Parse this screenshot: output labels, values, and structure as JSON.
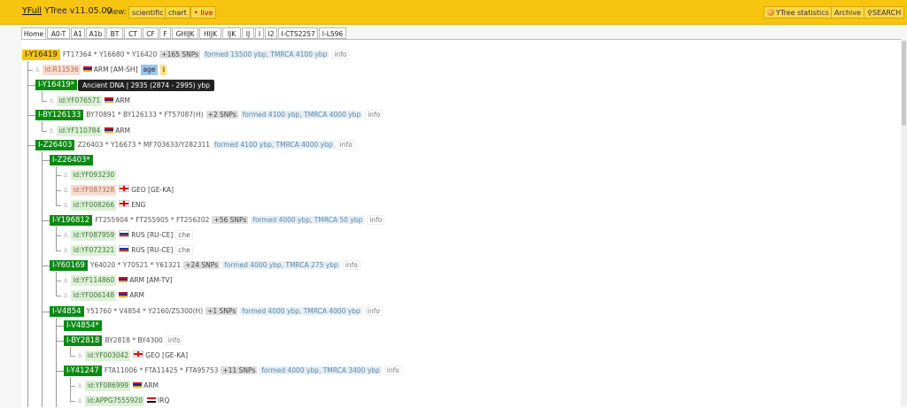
{
  "header": {
    "brand_yfull": "YFull",
    "brand_rest": "YTree v11.05.00",
    "view_label": "View:",
    "view_buttons": [
      "scientific",
      "chart",
      "• live"
    ],
    "stats": "YTree statistics",
    "archive": "Archive",
    "search": "SEARCH"
  },
  "tabs": [
    "Home",
    "A0-T",
    "A1",
    "A1b",
    "BT",
    "CT",
    "CF",
    "F",
    "GHIJK",
    "HIJK",
    "IJK",
    "IJ",
    "I",
    "I2",
    "I-CTS2257",
    "I-L596"
  ],
  "tree": {
    "root": {
      "name": "I-Y16419",
      "snps": "FT17364 * Y16680 * Y16420",
      "count": "+165 SNPs",
      "formed": "formed 15500 ybp, TMRCA 4100 ybp",
      "info": "info"
    },
    "root_sample": {
      "id": "id:R11536",
      "country": "ARM [AM-SH]",
      "age": "age",
      "age_icon": "ℹ"
    },
    "tooltip": "Ancient DNA | 2935 (2874 - 2995) ybp",
    "n_y16419s": {
      "name": "I-Y16419*"
    },
    "s_yf076571": {
      "id": "id:YF076571",
      "country": "ARM"
    },
    "n_by126133": {
      "name": "I-BY126133",
      "snps": "BY70891 * BY126133 * FT57087(H)",
      "count": "+2 SNPs",
      "formed": "formed 4100 ybp, TMRCA 4000 ybp",
      "info": "info"
    },
    "s_yf110784": {
      "id": "id:YF110784",
      "country": "ARM"
    },
    "n_z26403": {
      "name": "I-Z26403",
      "snps": "Z26403 * Y16673 * MF703633/Y282311",
      "formed": "formed 4100 ybp, TMRCA 4000 ybp",
      "info": "info"
    },
    "n_z26403s": {
      "name": "I-Z26403*"
    },
    "s_yf093230": {
      "id": "id:YF093230"
    },
    "s_yf087328": {
      "id": "id:YF087328",
      "country": "GEO [GE-KA]"
    },
    "s_yf008266": {
      "id": "id:YF008266",
      "country": "ENG"
    },
    "n_y196812": {
      "name": "I-Y196812",
      "snps": "FT255904 * FT255905 * FT256202",
      "count": "+56 SNPs",
      "formed": "formed 4000 ybp, TMRCA 50 ybp",
      "info": "info"
    },
    "s_yf087959": {
      "id": "id:YF087959",
      "country": "RUS [RU-CE]",
      "tag": "che"
    },
    "s_yf072321": {
      "id": "id:YF072321",
      "country": "RUS [RU-CE]",
      "tag": "che"
    },
    "n_y60169": {
      "name": "I-Y60169",
      "snps": "Y64020 * Y70521 * Y61321",
      "count": "+24 SNPs",
      "formed": "formed 4000 ybp, TMRCA 275 ybp",
      "info": "info"
    },
    "s_yf114860": {
      "id": "id:YF114860",
      "country": "ARM [AM-TV]"
    },
    "s_yf006148": {
      "id": "id:YF006148",
      "country": "ARM"
    },
    "n_v4854": {
      "name": "I-V4854",
      "snps": "Y51760 * V4854 * Y2160/ZS300(H)",
      "count": "+1 SNPs",
      "formed": "formed 4000 ybp, TMRCA 4000 ybp",
      "info": "info"
    },
    "n_v4854s": {
      "name": "I-V4854*"
    },
    "n_by2818": {
      "name": "I-BY2818",
      "snps": "BY2818 * BY4300",
      "info": "info"
    },
    "s_yf003042": {
      "id": "id:YF003042",
      "country": "GEO [GE-KA]"
    },
    "n_y41247": {
      "name": "I-Y41247",
      "snps": "FTA11006 * FTA11425 * FTA95753",
      "count": "+11 SNPs",
      "formed": "formed 4000 ybp, TMRCA 3400 ybp",
      "info": "info"
    },
    "s_yf086999": {
      "id": "id:YF086999",
      "country": "ARM"
    },
    "s_appg": {
      "id": "id:APPG7555920",
      "country": "IRQ"
    }
  }
}
